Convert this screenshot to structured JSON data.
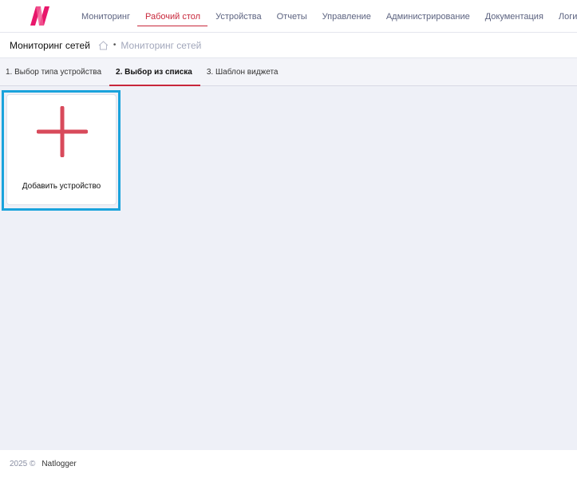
{
  "header": {
    "logo_icon": "brand-logo-icon",
    "nav": [
      {
        "label": "Мониторинг",
        "active": false
      },
      {
        "label": "Рабочий стол",
        "active": true
      },
      {
        "label": "Устройства",
        "active": false
      },
      {
        "label": "Отчеты",
        "active": false
      },
      {
        "label": "Управление",
        "active": false
      },
      {
        "label": "Администрирование",
        "active": false
      },
      {
        "label": "Документация",
        "active": false
      },
      {
        "label": "Логи",
        "active": false
      }
    ]
  },
  "page": {
    "title": "Мониторинг сетей",
    "breadcrumb_icon": "home-icon",
    "breadcrumb_separator": "•",
    "breadcrumb_current": "Мониторинг сетей"
  },
  "tabs": [
    {
      "label": "1. Выбор типа устройства",
      "active": false
    },
    {
      "label": "2. Выбор из списка",
      "active": true
    },
    {
      "label": "3. Шаблон виджета",
      "active": false
    }
  ],
  "add_card": {
    "icon": "plus-icon",
    "label": "Добавить устройство"
  },
  "footer": {
    "year": "2025 ©",
    "brand": "Natlogger"
  },
  "colors": {
    "accent": "#c8273b",
    "logo": "#e8176b",
    "plus": "#d84a5b",
    "selection": "#1aa3dc",
    "background": "#eef0f7"
  }
}
